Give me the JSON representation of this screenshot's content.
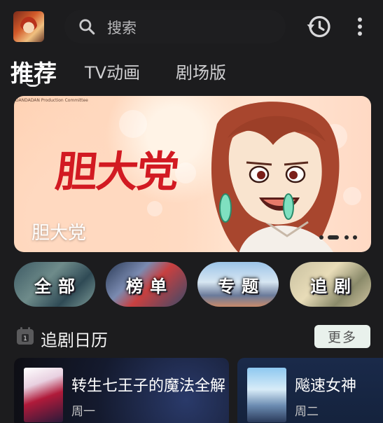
{
  "header": {
    "avatar_icon": "user-avatar",
    "search_placeholder": "搜索",
    "search_icon": "search-icon",
    "history_icon": "history-icon",
    "more_icon": "more-vertical-icon"
  },
  "tabs": [
    {
      "label": "推荐",
      "active": true
    },
    {
      "label": "TV动画",
      "active": false
    },
    {
      "label": "剧场版",
      "active": false
    }
  ],
  "banner": {
    "copyright": "DANDADAN Production Committee",
    "logo_text": "胆大党",
    "title": "胆大党",
    "page_count": 3,
    "current_page": 2
  },
  "categories": [
    {
      "label": "全部"
    },
    {
      "label": "榜单"
    },
    {
      "label": "专题"
    },
    {
      "label": "追剧"
    }
  ],
  "schedule": {
    "title": "追剧日历",
    "more_label": "更多",
    "items": [
      {
        "title": "转生七王子的魔法全解",
        "day": "周一"
      },
      {
        "title": "飚速女神",
        "day": "周二"
      }
    ]
  },
  "colors": {
    "background": "#1c1c1e",
    "logo_red": "#d21a22",
    "more_button_bg": "#e9f1ec"
  }
}
